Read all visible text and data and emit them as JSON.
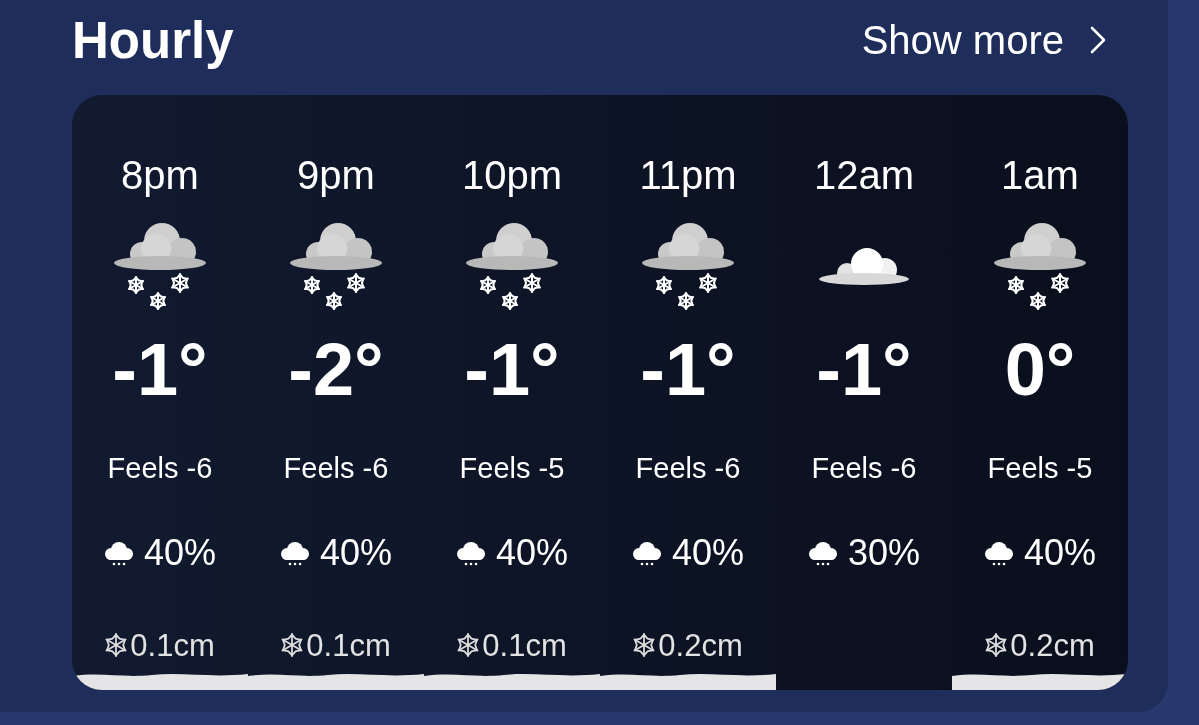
{
  "header": {
    "title": "Hourly",
    "link": "Show more"
  },
  "hours": [
    {
      "time": "8pm",
      "kind": "snow",
      "temp": "-1°",
      "feels": "Feels -6",
      "precip": "40%",
      "snow": "0.1cm"
    },
    {
      "time": "9pm",
      "kind": "snow",
      "temp": "-2°",
      "feels": "Feels -6",
      "precip": "40%",
      "snow": "0.1cm"
    },
    {
      "time": "10pm",
      "kind": "snow",
      "temp": "-1°",
      "feels": "Feels -5",
      "precip": "40%",
      "snow": "0.1cm"
    },
    {
      "time": "11pm",
      "kind": "snow",
      "temp": "-1°",
      "feels": "Feels -6",
      "precip": "40%",
      "snow": "0.2cm"
    },
    {
      "time": "12am",
      "kind": "cloud",
      "temp": "-1°",
      "feels": "Feels -6",
      "precip": "30%"
    },
    {
      "time": "1am",
      "kind": "snow",
      "temp": "0°",
      "feels": "Feels -5",
      "precip": "40%",
      "snow": "0.2cm"
    }
  ]
}
